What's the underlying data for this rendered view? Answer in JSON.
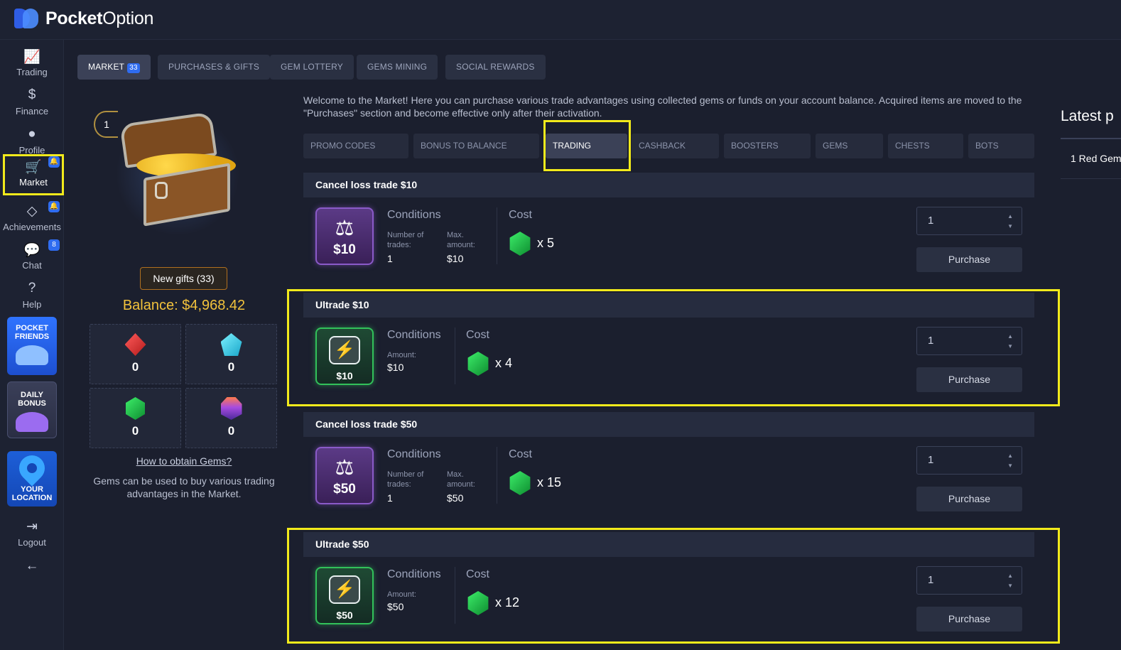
{
  "brand": {
    "name_bold": "Pocket",
    "name_light": "Option"
  },
  "sidebar": {
    "items": [
      {
        "label": "Trading",
        "icon": "chart-line-icon"
      },
      {
        "label": "Finance",
        "icon": "dollar-icon"
      },
      {
        "label": "Profile",
        "icon": "user-icon"
      },
      {
        "label": "Market",
        "icon": "cart-icon"
      },
      {
        "label": "Achievements",
        "icon": "diamond-icon"
      },
      {
        "label": "Chat",
        "icon": "chat-icon",
        "badge": "8"
      },
      {
        "label": "Help",
        "icon": "help-icon"
      },
      {
        "label": "Logout",
        "icon": "logout-icon"
      }
    ],
    "promo_friends": "POCKET FRIENDS",
    "promo_daily": "DAILY BONUS",
    "promo_location": "YOUR LOCATION"
  },
  "top_tabs": [
    {
      "label": "MARKET",
      "count": "33"
    },
    {
      "label": "PURCHASES & GIFTS"
    },
    {
      "label": "GEM LOTTERY"
    },
    {
      "label": "GEMS MINING"
    },
    {
      "label": "SOCIAL REWARDS"
    }
  ],
  "left_panel": {
    "level": "1",
    "new_gifts": "New gifts (33)",
    "balance": "Balance: $4,968.42",
    "gems": [
      {
        "type": "red",
        "value": "0"
      },
      {
        "type": "blue",
        "value": "0"
      },
      {
        "type": "green",
        "value": "0"
      },
      {
        "type": "purple",
        "value": "0"
      }
    ],
    "how_to": "How to obtain Gems?",
    "info": "Gems can be used to buy various trading advantages in the Market."
  },
  "intro": "Welcome to the Market! Here you can purchase various trade advantages using collected gems or funds on your account balance. Acquired items are moved to the \"Purchases\" section and become effective only after their activation.",
  "category_tabs": [
    "PROMO CODES",
    "BONUS TO BALANCE",
    "TRADING",
    "CASHBACK",
    "BOOSTERS",
    "GEMS",
    "CHESTS",
    "BOTS"
  ],
  "labels": {
    "conditions": "Conditions",
    "cost": "Cost",
    "num_trades": "Number of trades:",
    "max_amount": "Max. amount:",
    "amount": "Amount:",
    "purchase": "Purchase"
  },
  "products": [
    {
      "title": "Cancel loss trade $10",
      "thumb": "$10",
      "trades": "1",
      "max": "$10",
      "cost": "x 5",
      "qty": "1"
    },
    {
      "title": "Ultrade $10",
      "thumb": "$10",
      "amount": "$10",
      "cost": "x 4",
      "qty": "1"
    },
    {
      "title": "Cancel loss trade $50",
      "thumb": "$50",
      "trades": "1",
      "max": "$50",
      "cost": "x 15",
      "qty": "1"
    },
    {
      "title": "Ultrade $50",
      "thumb": "$50",
      "amount": "$50",
      "cost": "x 12",
      "qty": "1"
    }
  ],
  "latest": {
    "title": "Latest p",
    "item": "1 Red Gem"
  },
  "colors": {
    "accent": "#2f6cf0",
    "highlight": "#f2ea1b",
    "balance": "#f2c23c"
  }
}
